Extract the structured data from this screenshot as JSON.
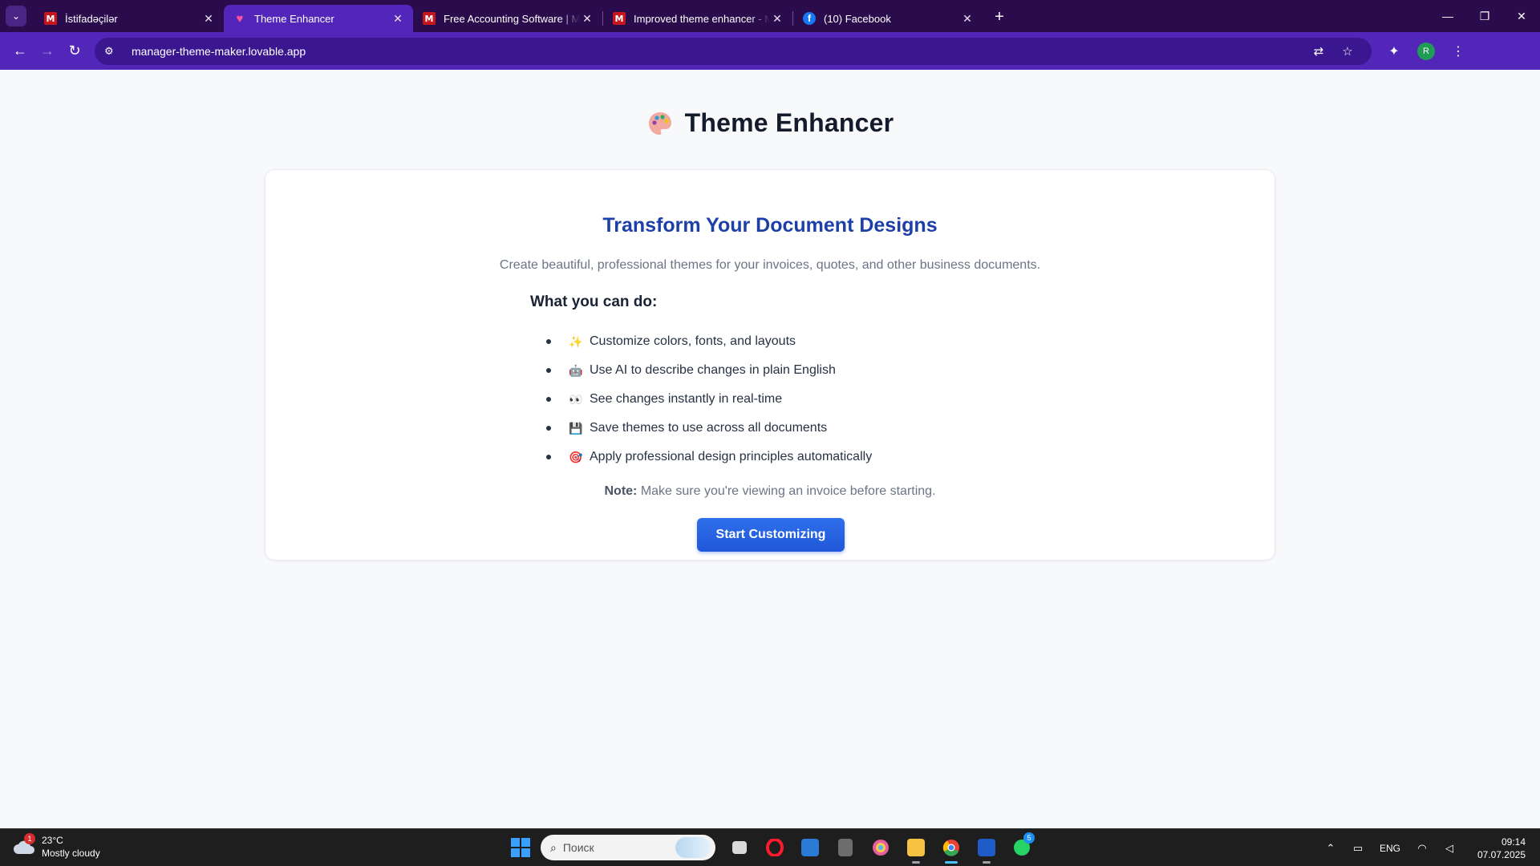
{
  "browser": {
    "tabs": [
      {
        "title": "İstifadəçilər",
        "favicon": "manager-m-icon",
        "active": false
      },
      {
        "title": "Theme Enhancer",
        "favicon": "heart-icon",
        "active": true
      },
      {
        "title": "Free Accounting Software | Manager",
        "favicon": "manager-m-icon",
        "active": false
      },
      {
        "title": "Improved theme enhancer - Manager",
        "favicon": "manager-m-icon",
        "active": false
      },
      {
        "title": "(10) Facebook",
        "favicon": "facebook-icon",
        "active": false
      }
    ],
    "favicon_letters": {
      "manager": "M",
      "facebook": "f"
    },
    "url": "manager-theme-maker.lovable.app",
    "profile_initial": "R",
    "colors": {
      "tabbar": "#2a0c4c",
      "toolbar": "#5126b8",
      "omnibox": "#3a1690"
    }
  },
  "page": {
    "app_title": "Theme Enhancer",
    "card": {
      "title": "Transform Your Document Designs",
      "subtitle": "Create beautiful, professional themes for your invoices, quotes, and other business documents.",
      "features_heading": "What you can do:",
      "features": [
        {
          "emoji": "✨",
          "text": "Customize colors, fonts, and layouts"
        },
        {
          "emoji": "🤖",
          "text": "Use AI to describe changes in plain English"
        },
        {
          "emoji": "👀",
          "text": "See changes instantly in real-time"
        },
        {
          "emoji": "💾",
          "text": "Save themes to use across all documents"
        },
        {
          "emoji": "🎯",
          "text": "Apply professional design principles automatically"
        }
      ],
      "note_label": "Note:",
      "note_text": " Make sure you're viewing an invoice before starting.",
      "button_label": "Start Customizing"
    },
    "colors": {
      "title_blue": "#1d3fa8",
      "button_blue": "#1f57d9"
    }
  },
  "taskbar": {
    "weather": {
      "temp": "23°C",
      "desc": "Mostly cloudy",
      "badge": "1"
    },
    "search_placeholder": "Поиск",
    "whatsapp_badge": "5",
    "tray": {
      "lang": "ENG",
      "time": "09:14",
      "date": "07.07.2025"
    }
  }
}
